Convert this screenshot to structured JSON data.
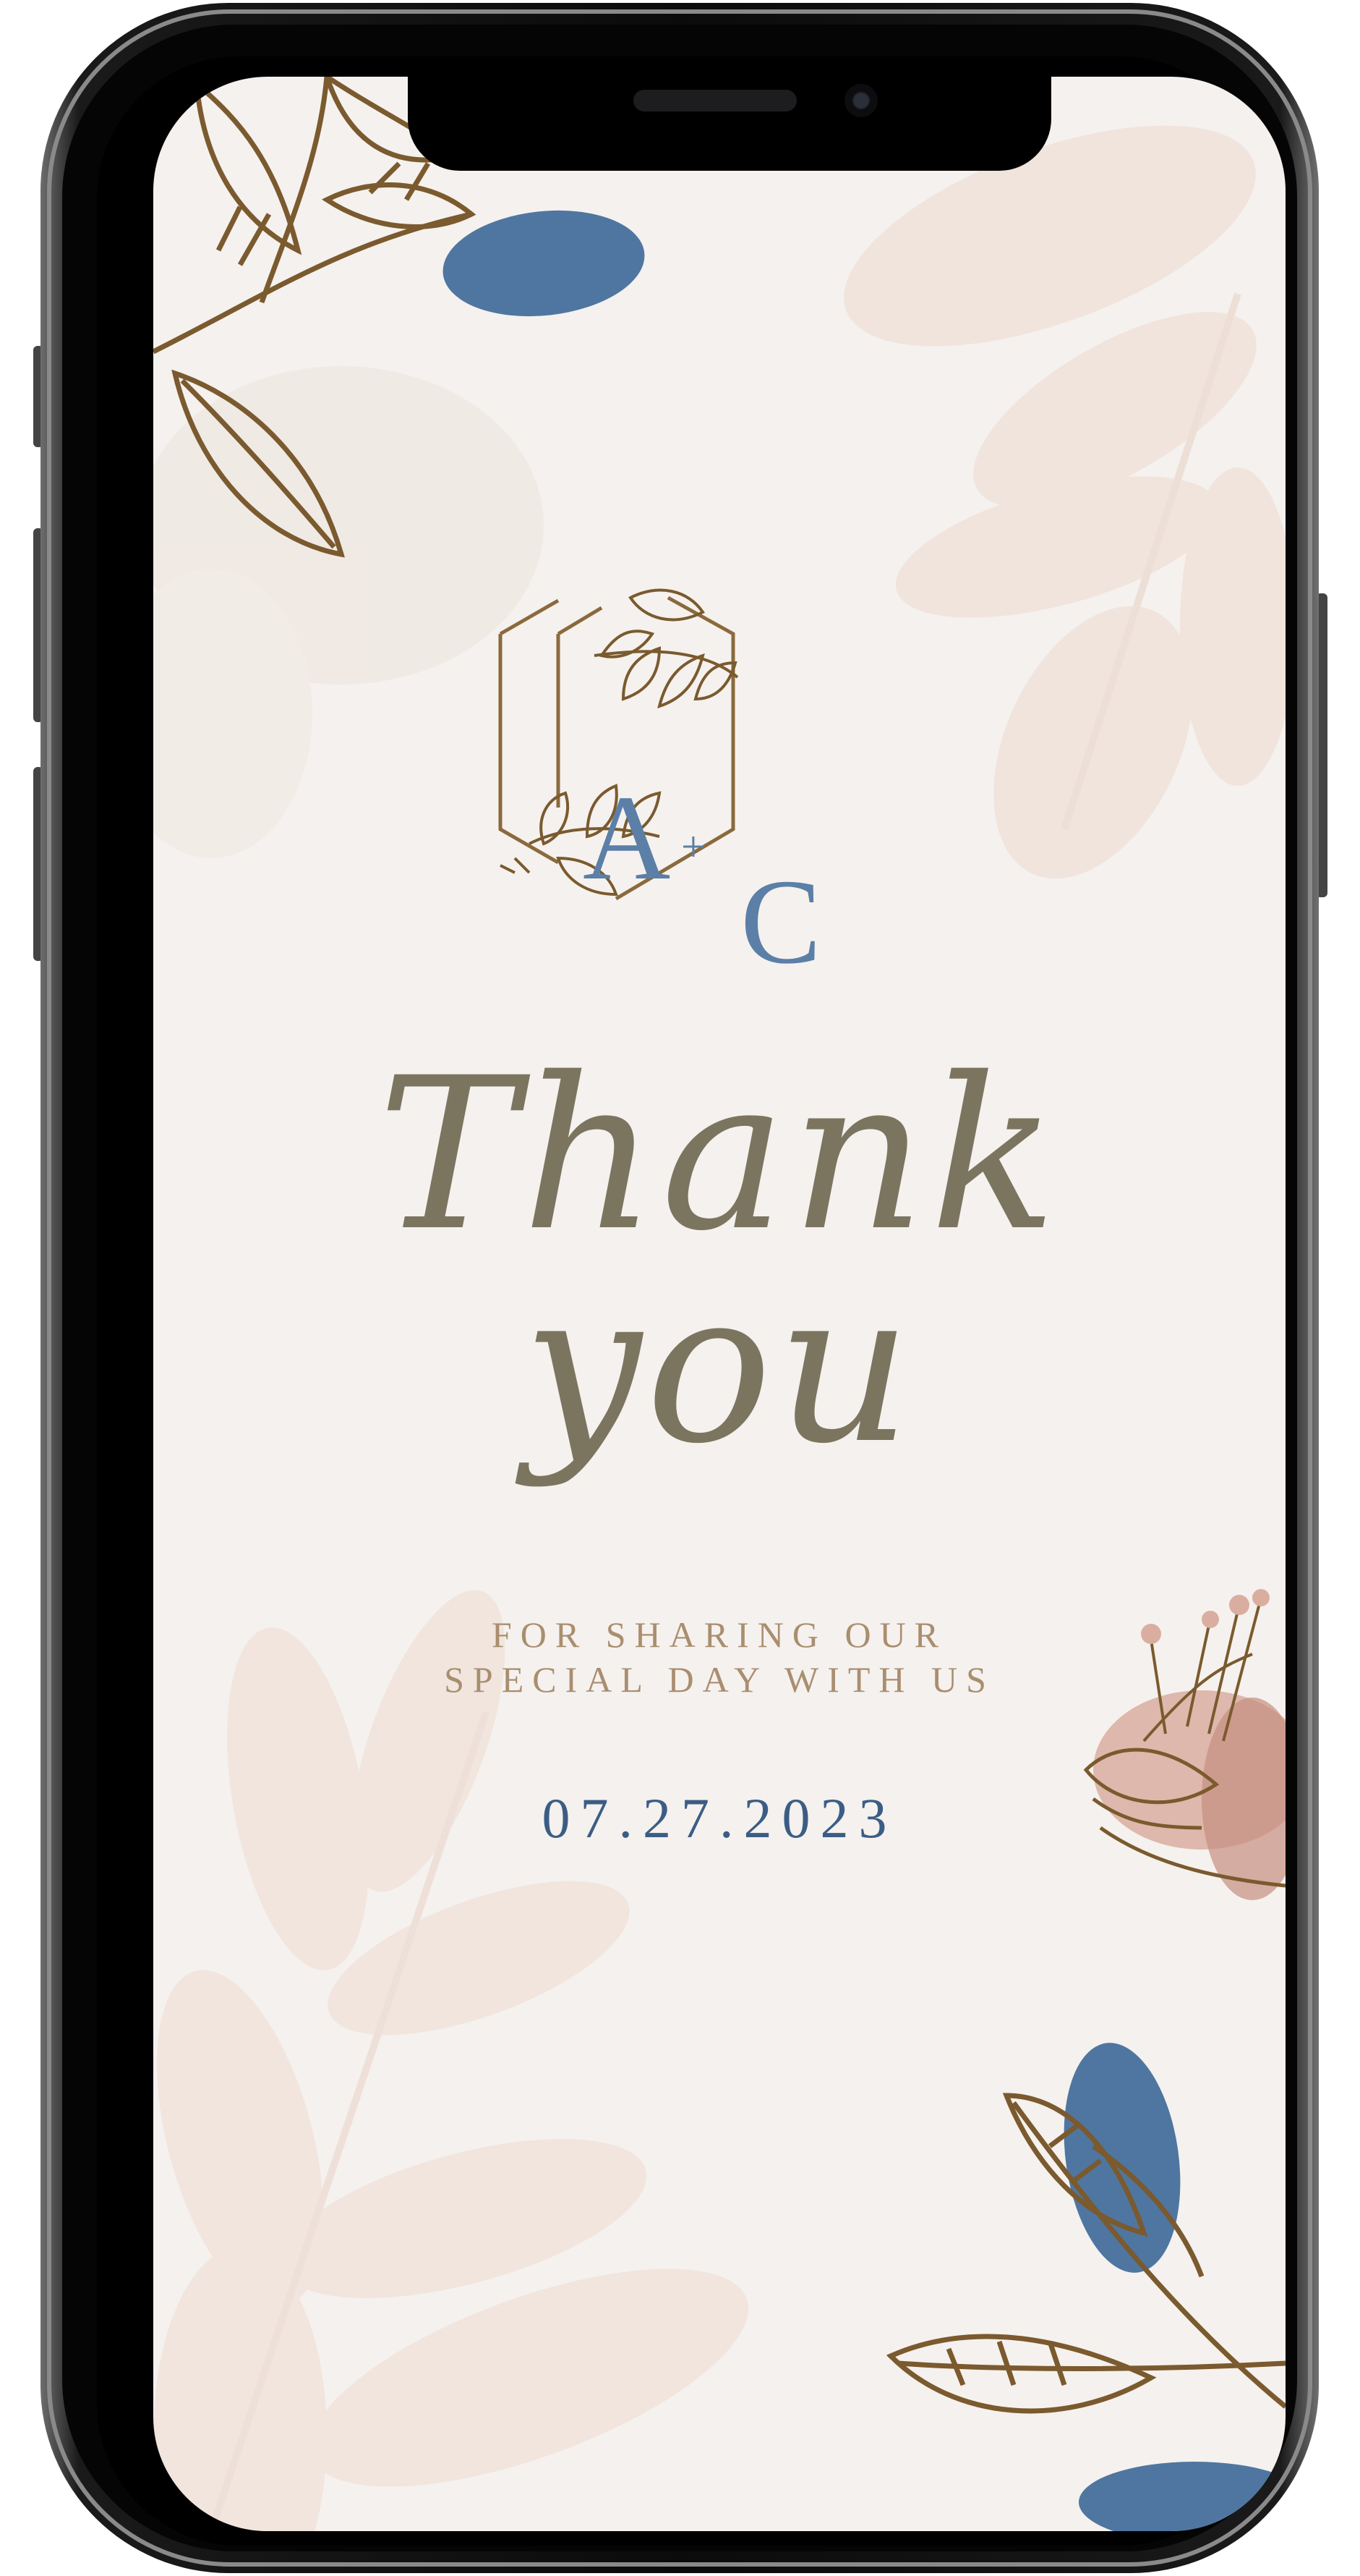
{
  "card": {
    "monogram": {
      "left": "A",
      "plus": "+",
      "right": "C"
    },
    "title_line1": "Thank",
    "title_line2": "you",
    "subtitle_line1": "FOR SHARING OUR",
    "subtitle_line2": "SPECIAL DAY WITH US",
    "date": "07.27.2023"
  },
  "colors": {
    "background": "#f5f1ee",
    "title": "#7b7560",
    "subtitle": "#a98e6f",
    "date": "#3b5d85",
    "monogram": "#5b7fa7",
    "leaf_outline": "#7a5a2e",
    "blue_wash": "#3d6897",
    "blush_wash": "#e8d3c8",
    "phone_frame": "#111111"
  },
  "icons": {
    "monogram_frame": "hexagon-icon",
    "leaf_sprig": "leaf-sprig-icon",
    "flower": "flower-icon"
  }
}
